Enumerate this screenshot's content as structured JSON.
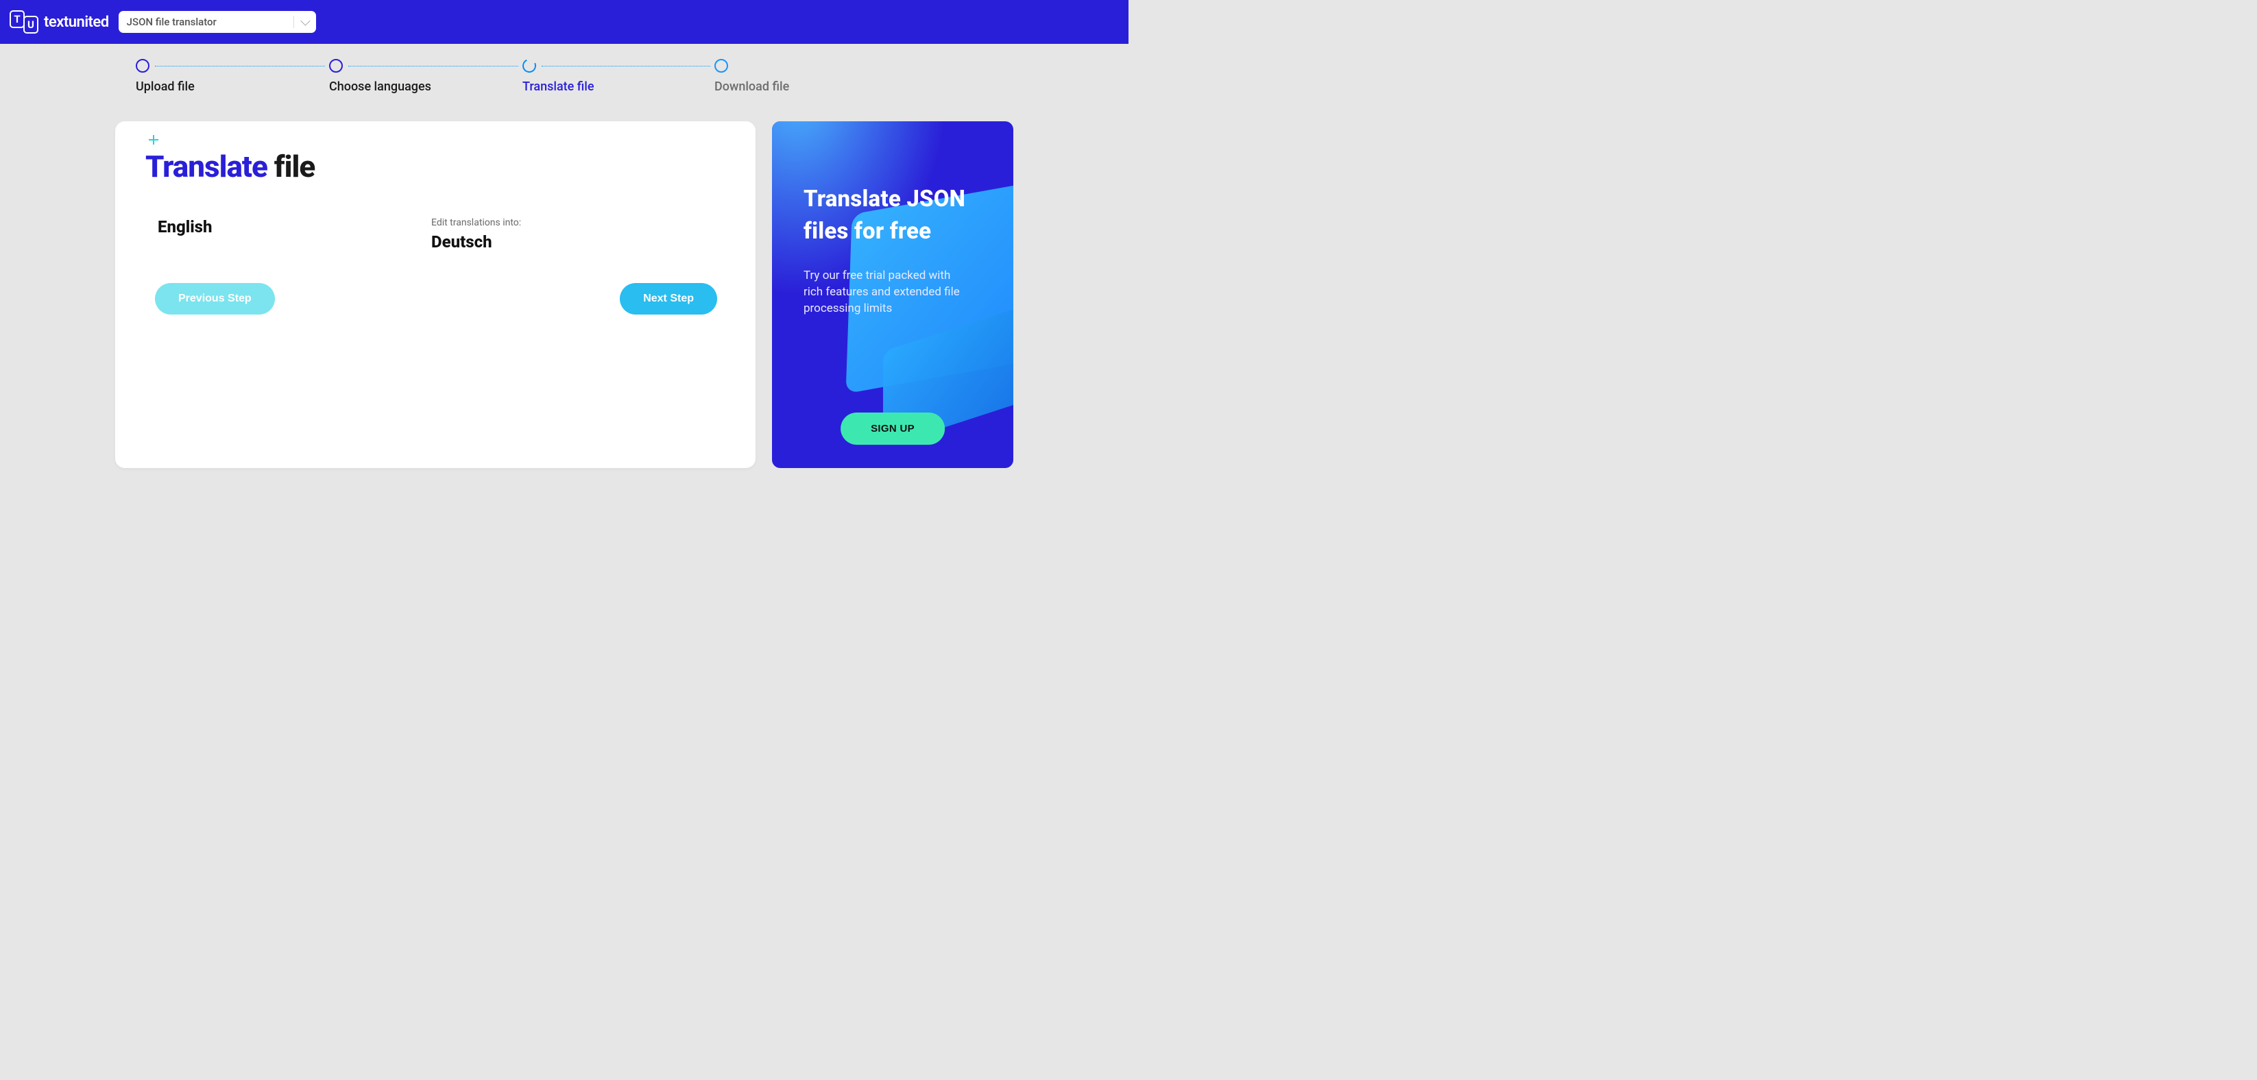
{
  "header": {
    "brand": "textunited",
    "selector_value": "JSON file translator"
  },
  "stepper": {
    "steps": [
      {
        "label": "Upload file",
        "state": "done"
      },
      {
        "label": "Choose languages",
        "state": "done"
      },
      {
        "label": "Translate file",
        "state": "active"
      },
      {
        "label": "Download file",
        "state": "disabled"
      }
    ]
  },
  "card": {
    "title_blue": "Translate",
    "title_dark": "file",
    "source_label": "",
    "source_language": "English",
    "target_label": "Edit translations into:",
    "target_language": "Deutsch",
    "prev_button": "Previous Step",
    "next_button": "Next Step"
  },
  "promo": {
    "headline": "Translate JSON files for free",
    "body": "Try our free trial packed with rich features and extended file processing limits",
    "cta": "SIGN UP"
  }
}
